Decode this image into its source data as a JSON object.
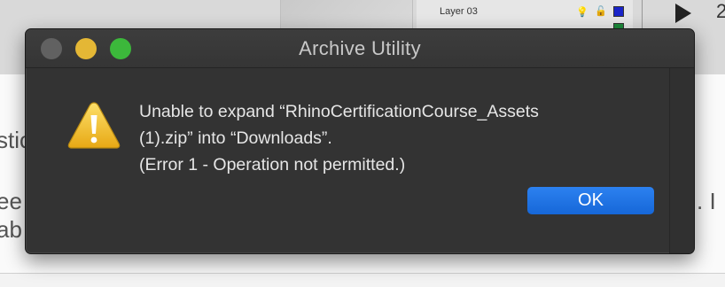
{
  "background": {
    "layer_label": "Layer 03",
    "number_glyph": "2",
    "text_fragments": [
      "stic",
      "ee",
      "ab",
      ". I"
    ]
  },
  "dialog": {
    "title": "Archive Utility",
    "message_lines": [
      "Unable to expand “RhinoCertificationCourse_Assets",
      "(1).zip” into “Downloads”.",
      "(Error 1 - Operation not permitted.)"
    ],
    "ok_label": "OK",
    "icon": "warning-triangle-icon"
  },
  "colors": {
    "dialog_bg": "#333333",
    "accent_button": "#1a6fe0",
    "close_button": "#616161",
    "minimize_button": "#e4b735",
    "zoom_button": "#3cb83b",
    "warning_yellow": "#f2c12e"
  }
}
